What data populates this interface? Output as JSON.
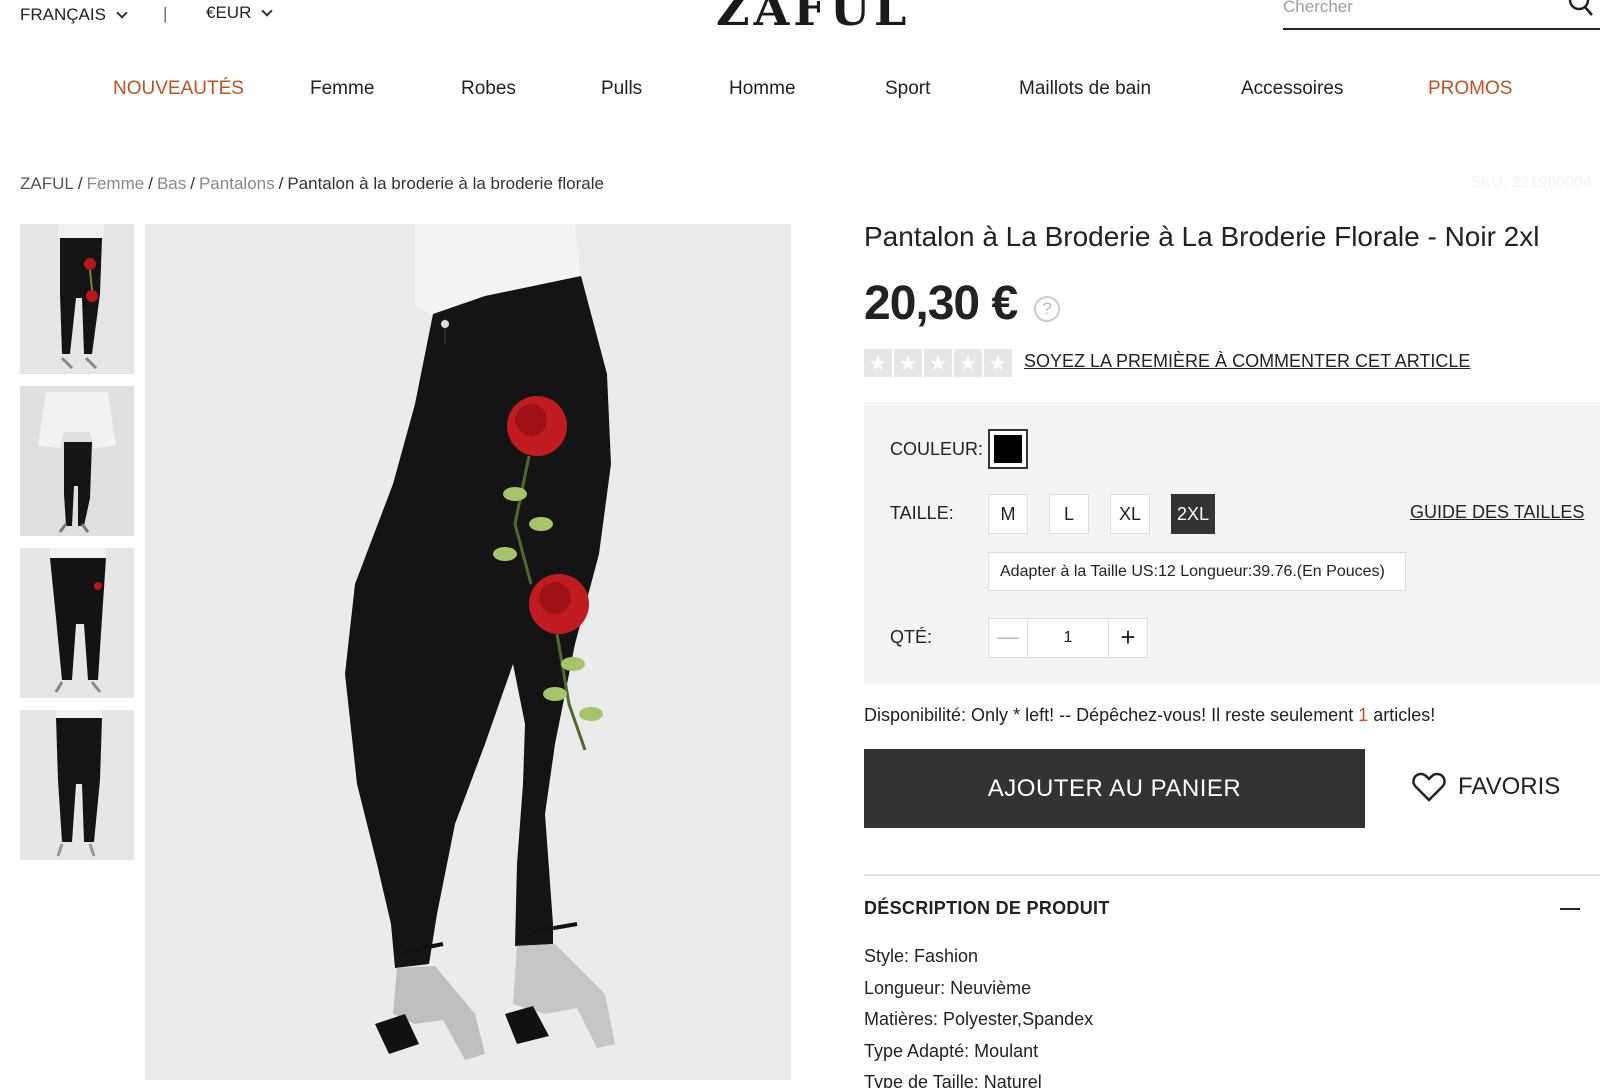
{
  "topbar": {
    "language": "FRANÇAIS",
    "separator": "|",
    "currency": "€EUR",
    "logo": "ZAFUL",
    "search_placeholder": "Chercher"
  },
  "nav": {
    "items": [
      {
        "label": "NOUVEAUTÉS",
        "accent": true
      },
      {
        "label": "Femme"
      },
      {
        "label": "Robes"
      },
      {
        "label": "Pulls"
      },
      {
        "label": "Homme"
      },
      {
        "label": "Sport"
      },
      {
        "label": "Maillots de bain"
      },
      {
        "label": "Accessoires"
      },
      {
        "label": "PROMOS",
        "accent": true
      }
    ]
  },
  "breadcrumb": {
    "items": [
      "ZAFUL",
      "Femme",
      "Bas",
      "Pantalons"
    ],
    "current": "Pantalon à la broderie à la broderie florale",
    "sku": "SKU: 221980004"
  },
  "product": {
    "title": "Pantalon à La Broderie à La Broderie Florale - Noir 2xl",
    "price": "20,30 €",
    "help": "?",
    "rating_stars": 0,
    "review_link": "SOYEZ LA PREMIÈRE À COMMENTER CET ARTICLE",
    "color_label": "COULEUR:",
    "color_value": "#000000",
    "size_label": "TAILLE:",
    "sizes": [
      "M",
      "L",
      "XL",
      "2XL"
    ],
    "selected_size": "2XL",
    "size_guide": "GUIDE DES TAILLES",
    "size_note": "Adapter à la Taille US:12   Longueur:39.76.(En Pouces)",
    "qty_label": "QTÉ:",
    "qty_value": "1",
    "availability_prefix": "Disponibilité: Only * left! -- Dépêchez-vous! Il reste seulement ",
    "availability_count": "1",
    "availability_suffix": " articles!",
    "add_to_cart": "AJOUTER AU PANIER",
    "favorites": "FAVORIS"
  },
  "description": {
    "title": "DÉSCRIPTION DE PRODUIT",
    "lines": [
      "Style: Fashion",
      "Longueur: Neuvième",
      "Matières: Polyester,Spandex",
      "Type Adapté: Moulant",
      "Type de Taille: Naturel"
    ]
  },
  "colors": {
    "accent": "#c4511f",
    "dark": "#333333",
    "panel": "#f4f4f4"
  }
}
